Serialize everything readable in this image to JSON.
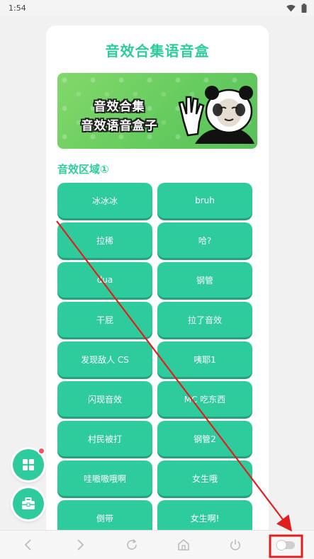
{
  "status_bar": {
    "time": "1:54",
    "icons": [
      "wifi-icon",
      "battery-icon"
    ]
  },
  "page": {
    "title": "音效合集语音盒",
    "banner": {
      "line1": "音效合集",
      "line2": "音效语音盒子",
      "image": "panda-meme"
    },
    "section_title": "音效区域①",
    "buttons": [
      "冰冰冰",
      "bruh",
      "拉稀",
      "哈?",
      "dua",
      "钢管",
      "干屁",
      "拉了音效",
      "发现敌人 CS",
      "咦耶1",
      "闪现音效",
      "MC 吃东西",
      "村民被打",
      "钢管2",
      "哇嗷嗷哦啊",
      "女生哦",
      "倒带",
      "女生啊!"
    ]
  },
  "floating_buttons": [
    {
      "icon": "apps-grid-icon",
      "has_badge": true
    },
    {
      "icon": "toolbox-icon",
      "has_badge": false
    }
  ],
  "bottom_nav": {
    "icons": [
      "back-icon",
      "forward-icon",
      "refresh-icon",
      "home-icon",
      "power-icon",
      "toggle-icon"
    ]
  },
  "colors": {
    "accent": "#2ecc9c",
    "annotation": "#e01e1e",
    "badge": "#ff4d5e"
  }
}
